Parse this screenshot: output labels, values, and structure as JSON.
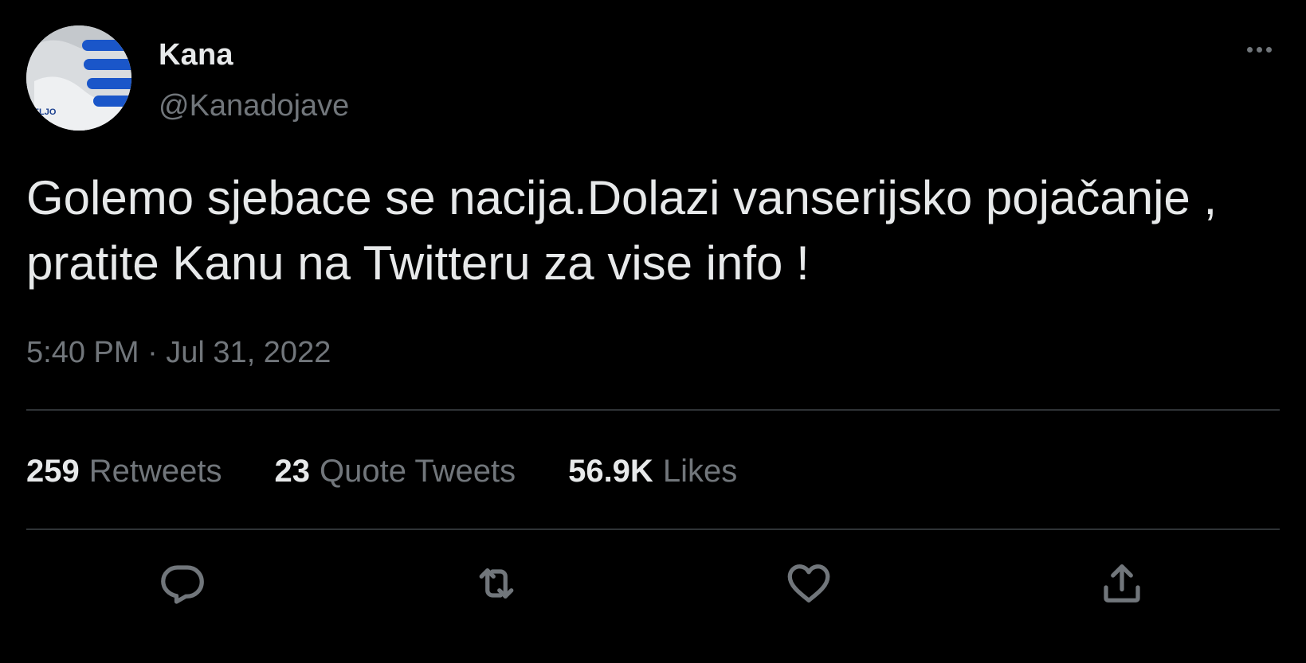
{
  "colors": {
    "background": "#000000",
    "primary_text": "#e7e9ea",
    "secondary_text": "#71767b",
    "divider": "#2f3336",
    "avatar_accent": "#1a56c9"
  },
  "author": {
    "name": "Kana",
    "handle": "@Kanadojave",
    "avatar_text": "ŽELJO"
  },
  "tweet": {
    "text_lines": [
      "Golemo sjebace se nacija.Dolazi vanserijsko pojačanje ,",
      "pratite Kanu na Twitteru za vise info !"
    ],
    "timestamp": "5:40 PM · Jul 31, 2022"
  },
  "stats": [
    {
      "count": "259",
      "label": "Retweets"
    },
    {
      "count": "23",
      "label": "Quote Tweets"
    },
    {
      "count": "56.9K",
      "label": "Likes"
    }
  ],
  "actions": {
    "reply": "reply-icon",
    "retweet": "retweet-icon",
    "like": "heart-icon",
    "share": "share-icon",
    "more": "more-icon"
  }
}
